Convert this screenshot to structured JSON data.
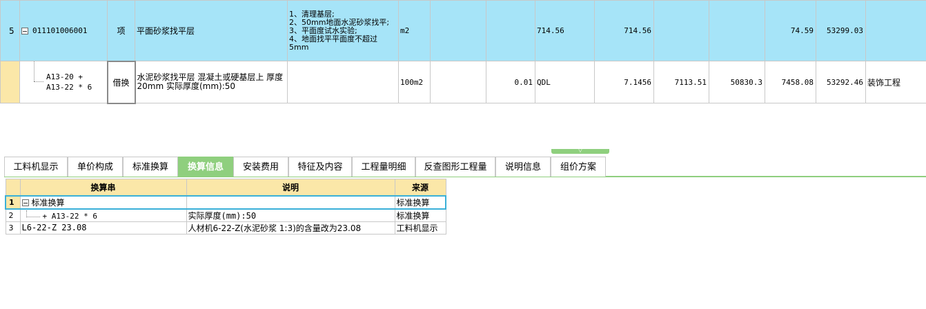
{
  "top_rows": [
    {
      "row_no": "5",
      "code": "011101006001",
      "type": "项",
      "name": "平面砂浆找平层",
      "features": [
        "1、清理基层;",
        "2、50mm地面水泥砂浆找平;",
        "3、平面度试水实验;",
        "4、地面找平平面度不超过5mm"
      ],
      "unit": "m2",
      "c7": "",
      "c8": "",
      "quantity": "714.56",
      "c10": "714.56",
      "c11": "",
      "c12": "",
      "c13": "74.59",
      "c14": "53299.03",
      "c15": ""
    },
    {
      "row_no": "",
      "code_line1": "A13-20 +",
      "code_line2": "A13-22 * 6",
      "type": "借换",
      "name": "水泥砂浆找平层 混凝土或硬基层上 厚度20mm  实际厚度(mm):50",
      "features": "",
      "unit": "100m2",
      "c7": "",
      "c8": "0.01",
      "quantity": "QDL",
      "c10": "7.1456",
      "c11": "7113.51",
      "c12": "50830.3",
      "c13": "7458.08",
      "c14": "53292.46",
      "c15": "装饰工程"
    }
  ],
  "tabs": [
    {
      "label": "工料机显示",
      "active": false
    },
    {
      "label": "单价构成",
      "active": false
    },
    {
      "label": "标准换算",
      "active": false
    },
    {
      "label": "换算信息",
      "active": true
    },
    {
      "label": "安装费用",
      "active": false
    },
    {
      "label": "特征及内容",
      "active": false
    },
    {
      "label": "工程量明细",
      "active": false
    },
    {
      "label": "反查图形工程量",
      "active": false
    },
    {
      "label": "说明信息",
      "active": false
    },
    {
      "label": "组价方案",
      "active": false
    }
  ],
  "detail": {
    "headers": [
      "换算串",
      "说明",
      "来源"
    ],
    "rows": [
      {
        "no": "1",
        "string": "标准换算",
        "desc": "",
        "source": "标准换算"
      },
      {
        "no": "2",
        "string": "+ A13-22 * 6",
        "desc": "实际厚度(mm):50",
        "source": "标准换算"
      },
      {
        "no": "3",
        "string": "L6-22-Z 23.08",
        "desc": "人材机6-22-Z(水泥砂浆 1:3)的含量改为23.08",
        "source": "工料机显示"
      }
    ]
  },
  "colors": {
    "row_highlight": "#a6e4f8",
    "tab_active": "#8fcf7e",
    "header_bg": "#fbe7a8",
    "selection_border": "#3ab0d8"
  }
}
